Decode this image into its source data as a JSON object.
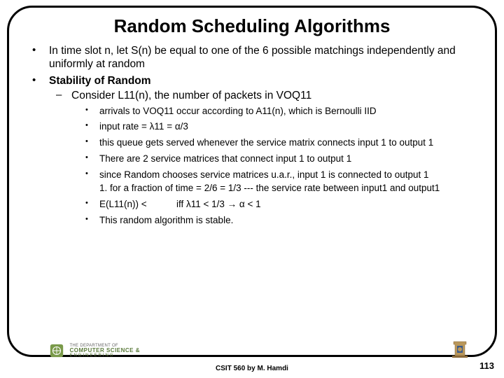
{
  "title": "Random Scheduling Algorithms",
  "bullets": {
    "b1": "In time slot n, let S(n) be equal to one of the 6 possible matchings independently and uniformly at random",
    "b2": "Stability of Random",
    "b2_sub": "Consider L11(n), the number of packets in VOQ11",
    "i1": "arrivals to VOQ11 occur according to A11(n), which is Bernoulli IID",
    "i2": "input rate = λ11 =  α/3",
    "i3": "this queue gets served whenever the service matrix connects input 1 to output 1",
    "i4": "There are 2 service matrices that connect input 1 to output 1",
    "i5": "since Random chooses service matrices u.a.r., input 1 is connected to output 1",
    "i5b": "1. for a fraction of time = 2/6 = 1/3  --- the service rate between input1 and output1",
    "i6a": "E(L11(n)) < ",
    "i6b": "iff λ11 < 1/3 → α < 1",
    "i7": " This random algorithm is stable."
  },
  "footer": {
    "center": "CSIT 560 by M. Hamdi",
    "page": "113",
    "dept_line1": "THE DEPARTMENT OF",
    "dept_line2": "COMPUTER SCIENCE &",
    "dept_line3": "ENGINEERING"
  }
}
